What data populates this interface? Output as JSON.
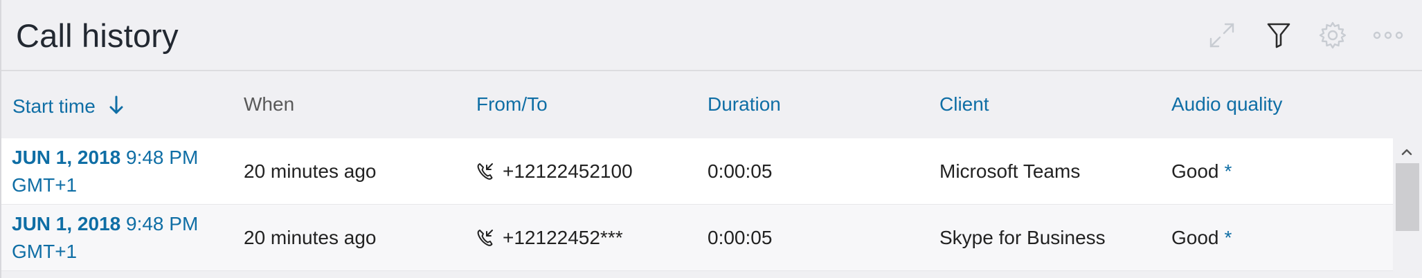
{
  "page": {
    "title": "Call history"
  },
  "toolbar": {
    "expand_icon": "expand-icon",
    "filter_icon": "filter-icon",
    "settings_icon": "gear-icon",
    "more_icon": "more-icon"
  },
  "columns": {
    "start_time": "Start time",
    "when": "When",
    "from_to": "From/To",
    "duration": "Duration",
    "client": "Client",
    "audio_quality": "Audio quality"
  },
  "sort": {
    "column": "start_time",
    "direction": "descending"
  },
  "rows": [
    {
      "date": "JUN 1, 2018",
      "time": "9:48 PM GMT+1",
      "when": "20 minutes ago",
      "from_to": "+12122452100",
      "duration": "0:00:05",
      "client": "Microsoft Teams",
      "audio_quality": "Good",
      "quality_marker": "*"
    },
    {
      "date": "JUN 1, 2018",
      "time": "9:48 PM GMT+1",
      "when": "20 minutes ago",
      "from_to": "+12122452***",
      "duration": "0:00:05",
      "client": "Skype for Business",
      "audio_quality": "Good",
      "quality_marker": "*"
    }
  ],
  "colors": {
    "accent": "#0f6ea5",
    "background": "#f0f0f3",
    "row_background": "#ffffff",
    "icon_disabled": "#c8ccd2"
  }
}
